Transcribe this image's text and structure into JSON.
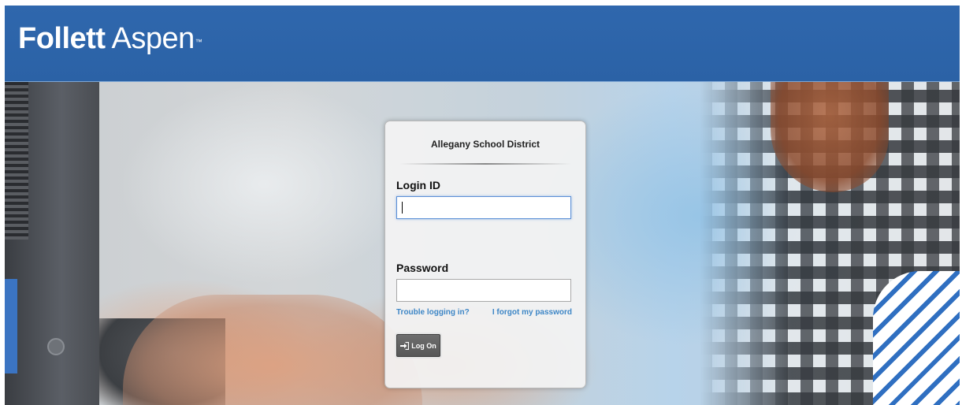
{
  "header": {
    "brand": "Follett",
    "product": "Aspen",
    "trademark": "™"
  },
  "login": {
    "district": "Allegany School District",
    "login_id_label": "Login ID",
    "login_id_value": "",
    "password_label": "Password",
    "password_value": "",
    "trouble_link": "Trouble logging in?",
    "forgot_link": "I forgot my password",
    "logon_button": "Log On",
    "logon_icon": "sign-in-icon"
  },
  "colors": {
    "header_blue": "#2f67ad",
    "link_blue": "#3d86c6",
    "button_gray": "#5f5f5f"
  }
}
